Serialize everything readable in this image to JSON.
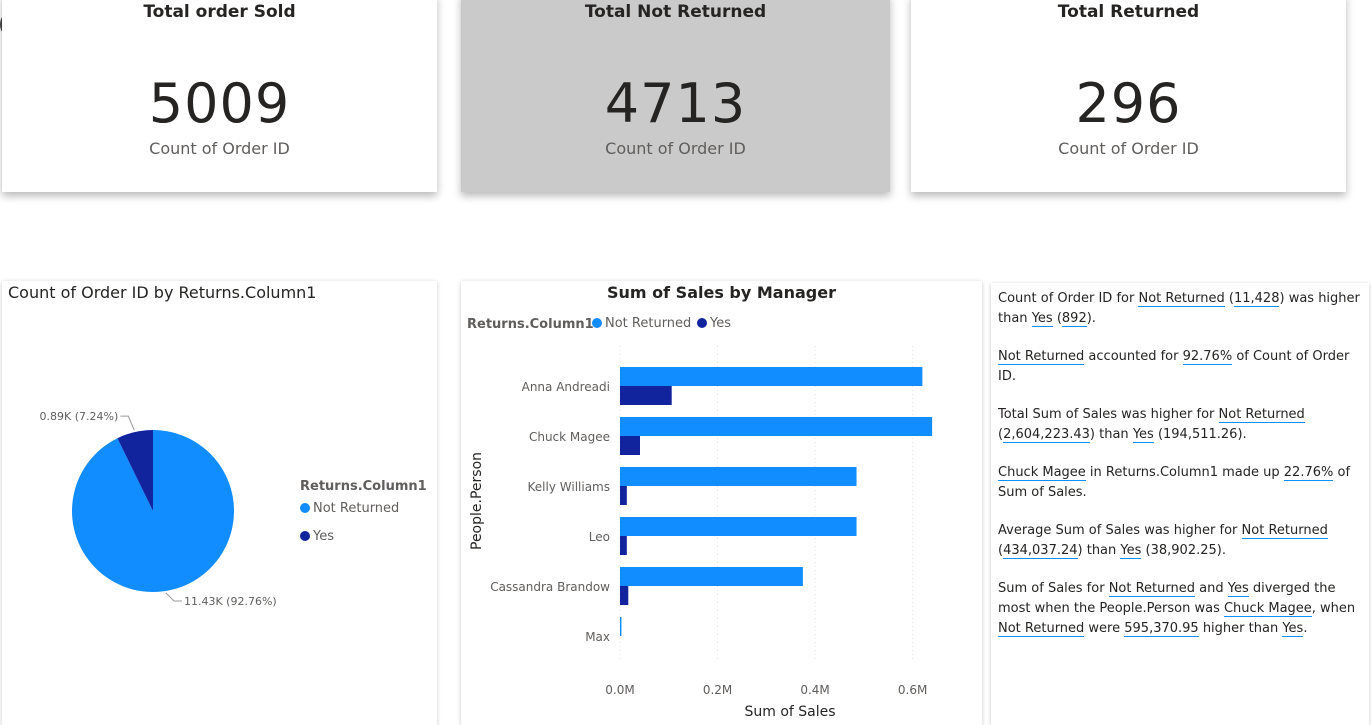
{
  "kpis": [
    {
      "title": "Total order Sold",
      "value": "5009",
      "label": "Count of Order ID"
    },
    {
      "title": "Total Not Returned",
      "value": "4713",
      "label": "Count of Order ID"
    },
    {
      "title": "Total Returned",
      "value": "296",
      "label": "Count of Order ID"
    }
  ],
  "pie": {
    "title": "Count of Order ID by Returns.Column1",
    "legend_title": "Returns.Column1",
    "legend": [
      "Not Returned",
      "Yes"
    ]
  },
  "bar": {
    "title": "Sum of Sales by Manager",
    "legend_title": "Returns.Column1",
    "legend": [
      "Not Returned",
      "Yes"
    ]
  },
  "colors": {
    "not_returned": "#118dff",
    "yes": "#12239e"
  },
  "chart_data": [
    {
      "type": "pie",
      "title": "Count of Order ID by Returns.Column1",
      "legend_title": "Returns.Column1",
      "slices": [
        {
          "name": "Not Returned",
          "value": 11428,
          "label": "11.43K (92.76%)"
        },
        {
          "name": "Yes",
          "value": 892,
          "label": "0.89K (7.24%)"
        }
      ]
    },
    {
      "type": "bar",
      "orientation": "horizontal",
      "title": "Sum of Sales by Manager",
      "xlabel": "Sum of Sales",
      "ylabel": "People.Person",
      "categories": [
        "Anna Andreadi",
        "Chuck Magee",
        "Kelly Williams",
        "Leo",
        "Cassandra Brandow",
        "Max"
      ],
      "series": [
        {
          "name": "Not Returned",
          "values": [
            620000,
            640000,
            485000,
            485000,
            375000,
            3000
          ]
        },
        {
          "name": "Yes",
          "values": [
            106000,
            41000,
            14000,
            14000,
            17000,
            0
          ]
        }
      ],
      "xlim": [
        0,
        650000
      ],
      "xticks": [
        "0.0M",
        "0.2M",
        "0.4M",
        "0.6M"
      ],
      "xtick_values": [
        0,
        200000,
        400000,
        600000
      ],
      "legend_position": "top-left"
    }
  ],
  "insights": {
    "p1": {
      "a": "Count of Order ID for ",
      "b": "Not Returned",
      "c": " (",
      "d": "11,428",
      "e": ") was higher than ",
      "f": "Yes",
      "g": " (",
      "h": "892",
      "i": ")."
    },
    "p2": {
      "a": "Not Returned",
      "b": " accounted for ",
      "c": "92.76%",
      "d": " of Count of Order ID."
    },
    "p3": {
      "a": "Total Sum of Sales was higher for ",
      "b": "Not Returned",
      "c": " (",
      "d": "2,604,223.43",
      "e": ") than ",
      "f": "Yes",
      "g": " (194,511.26)."
    },
    "p4": {
      "a": "Chuck Magee",
      "b": " in Returns.Column1  made up ",
      "c": "22.76%",
      "d": " of Sum of Sales."
    },
    "p5": {
      "a": "Average Sum of Sales was higher for ",
      "b": "Not Returned",
      "c": " (",
      "d": "434,037.24",
      "e": ") than ",
      "f": "Yes",
      "g": " (38,902.25)."
    },
    "p6": {
      "a": "Sum of Sales for ",
      "b": "Not Returned",
      "c": " and ",
      "d": "Yes",
      "e": " diverged the most when the People.Person was ",
      "f": "Chuck Magee",
      "g": ", when ",
      "h": "Not Returned",
      "i": " were ",
      "j": "595,370.95",
      "k": " higher than ",
      "l": "Yes",
      "m": "."
    }
  }
}
